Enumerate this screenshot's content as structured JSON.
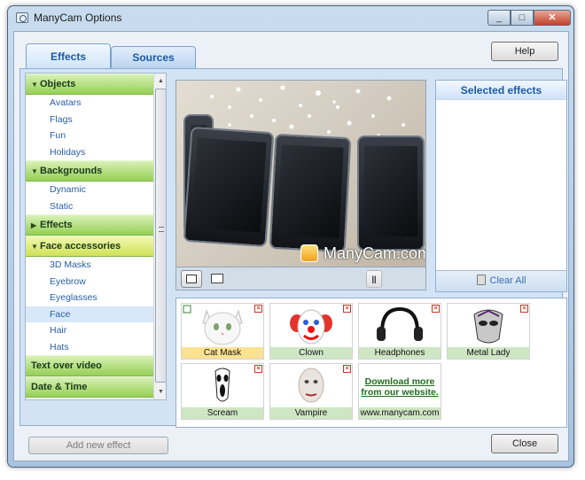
{
  "window": {
    "title": "ManyCam Options",
    "minimize_symbol": "_",
    "maximize_symbol": "□",
    "close_symbol": "✕"
  },
  "tabs": [
    {
      "label": "Effects",
      "active": true
    },
    {
      "label": "Sources",
      "active": false
    }
  ],
  "help_label": "Help",
  "sidebar": {
    "scroll_up": "▲",
    "scroll_down": "▼",
    "sections": [
      {
        "label": "Objects",
        "expanded": true,
        "items": [
          "Avatars",
          "Flags",
          "Fun",
          "Holidays"
        ]
      },
      {
        "label": "Backgrounds",
        "expanded": true,
        "items": [
          "Dynamic",
          "Static"
        ]
      },
      {
        "label": "Effects",
        "expanded": false,
        "items": []
      },
      {
        "label": "Face accessories",
        "expanded": true,
        "selected": true,
        "items": [
          "3D Masks",
          "Eyebrow",
          "Eyeglasses",
          "Face",
          "Hair",
          "Hats"
        ]
      },
      {
        "label": "Text over video",
        "expanded": false,
        "items": []
      },
      {
        "label": "Date & Time",
        "expanded": false,
        "items": []
      }
    ],
    "selected_item": "Face"
  },
  "add_effect_label": "Add new effect",
  "preview": {
    "watermark": "ManyCam.com",
    "pause_symbol": "||"
  },
  "selected_effects": {
    "title": "Selected effects",
    "clear_label": "Clear All"
  },
  "gallery": {
    "items": [
      {
        "label": "Cat Mask",
        "selected": true
      },
      {
        "label": "Clown",
        "selected": false
      },
      {
        "label": "Headphones",
        "selected": false
      },
      {
        "label": "Metal Lady",
        "selected": false
      },
      {
        "label": "Scream",
        "selected": false
      },
      {
        "label": "Vampire",
        "selected": false
      }
    ],
    "download_text": "Download more from our website.",
    "download_url": "www.manycam.com",
    "remove_symbol": "×"
  },
  "close_label": "Close",
  "colors": {
    "accent": "#1b5aa6",
    "category_green": "#95d055",
    "category_selected": "#cfe256",
    "selected_caption": "#fbe293"
  }
}
